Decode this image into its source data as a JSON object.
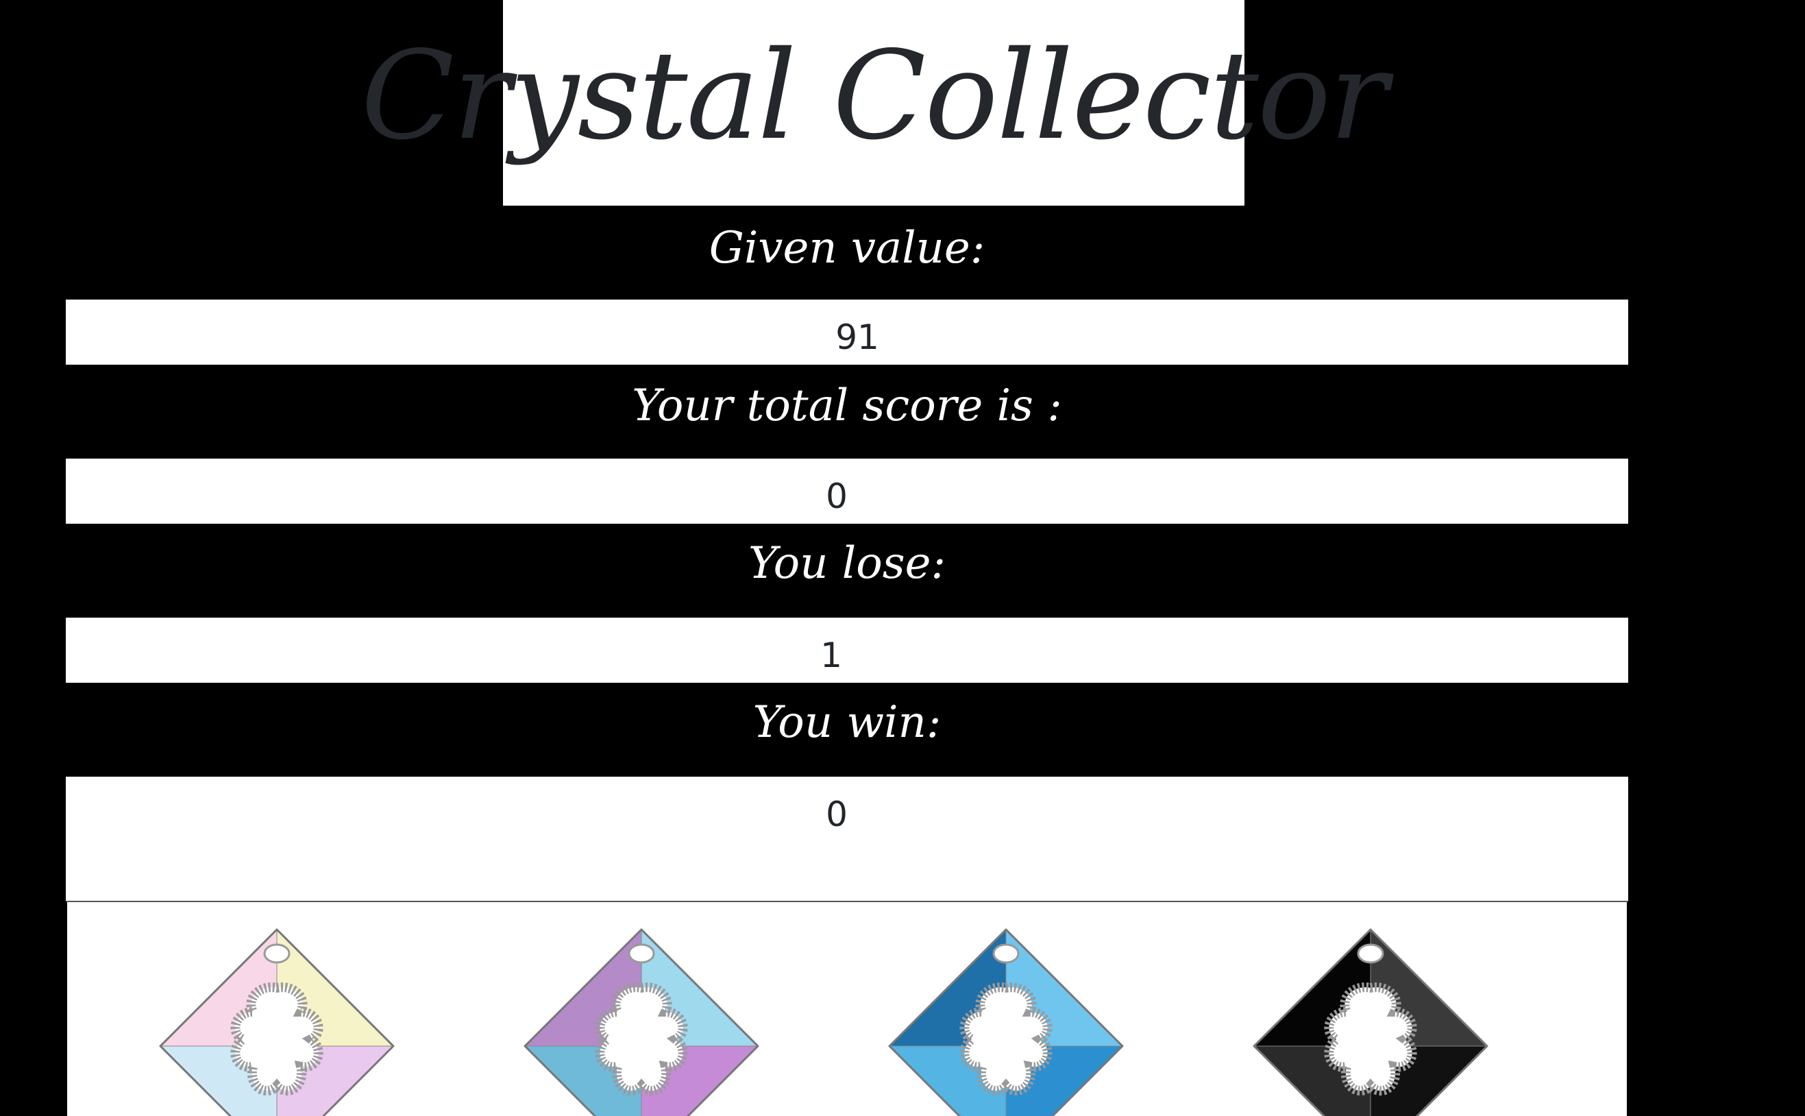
{
  "title": "Crystal Collector",
  "stats": [
    {
      "label": "Given value:",
      "value": "91"
    },
    {
      "label": "Your total score is :",
      "value": "0"
    },
    {
      "label": "You lose:",
      "value": "1"
    },
    {
      "label": "You win:",
      "value": "0"
    }
  ],
  "crystals": [
    {
      "name": "aurora-crystal",
      "colors": [
        "#f6f3c8",
        "#e9c9ee",
        "#cfe8f5",
        "#f8d8e8"
      ]
    },
    {
      "name": "violet-blue-crystal",
      "colors": [
        "#9ed9ee",
        "#c58bd6",
        "#6fb9d9",
        "#b58ac9"
      ]
    },
    {
      "name": "blue-crystal",
      "colors": [
        "#6fc5ee",
        "#2b8fd0",
        "#54b4e3",
        "#1f6fa8"
      ]
    },
    {
      "name": "black-crystal",
      "colors": [
        "#3a3a3a",
        "#111111",
        "#2a2a2a",
        "#050505"
      ]
    }
  ]
}
